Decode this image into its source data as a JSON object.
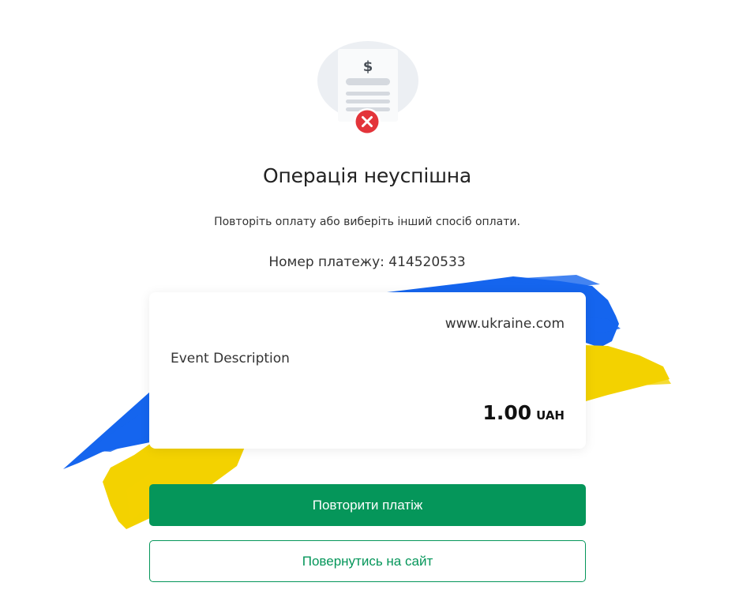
{
  "status": {
    "title": "Операція неуспішна",
    "subtitle": "Повторіть оплату або виберіть інший спосіб оплати.",
    "payment_number": "Номер платежу: 414520533",
    "illustration": {
      "document_symbol": "$",
      "status_icon": "close-icon"
    }
  },
  "order": {
    "site": "www.ukraine.com",
    "description": "Event Description",
    "amount": "1.00",
    "currency": "UAH"
  },
  "actions": {
    "retry_label": "Повторити платіж",
    "back_label": "Повернутись на сайт"
  },
  "colors": {
    "accent": "#05965a",
    "error": "#e3343a",
    "flag_blue": "#1565ee",
    "flag_yellow": "#f3d200"
  }
}
